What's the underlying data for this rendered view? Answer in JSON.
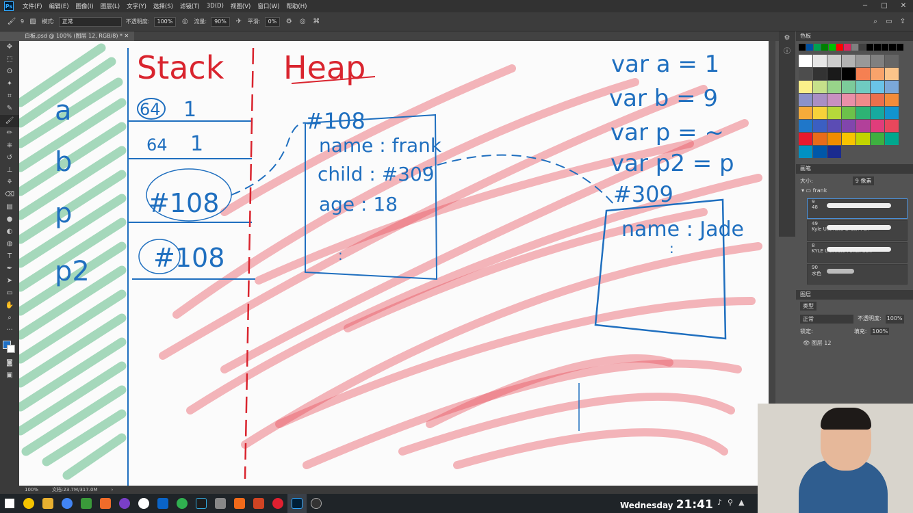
{
  "menubar": {
    "app_icon": "Ps",
    "items": [
      "文件(F)",
      "编辑(E)",
      "图像(I)",
      "图层(L)",
      "文字(Y)",
      "选择(S)",
      "滤镜(T)",
      "3D(D)",
      "视图(V)",
      "窗口(W)",
      "帮助(H)"
    ],
    "window_controls": [
      "─",
      "□",
      "✕"
    ]
  },
  "options": {
    "brush_size": "9",
    "mode_label": "模式:",
    "mode_value": "正常",
    "opacity_label": "不透明度:",
    "opacity_value": "100%",
    "flow_label": "流量:",
    "flow_value": "90%",
    "smooth_label": "平滑:",
    "smooth_value": "0%"
  },
  "document": {
    "tab_title": "白板.psd @ 100% (图层 12, RGB/8) *",
    "close": "✕"
  },
  "status": {
    "zoom": "100%",
    "doc_info": "文档:23.7M/317.0M"
  },
  "swatches_panel": {
    "title": "色板",
    "top_row": [
      "#000000",
      "#0050a0",
      "#00a050",
      "#008000",
      "#00c000",
      "#ff0000",
      "#e0245e",
      "#808080",
      "#404040",
      "#000000",
      "#000000",
      "#000000",
      "#000000",
      "#000000"
    ],
    "rows": [
      [
        "#ffffff",
        "#e6e6e6",
        "#cccccc",
        "#b3b3b3",
        "#999999",
        "#808080",
        "#666666"
      ],
      [
        "#4d4d4d",
        "#333333",
        "#1a1a1a",
        "#000000",
        "#f58052",
        "#f8a36b",
        "#fbc48a"
      ],
      [
        "#fbf08a",
        "#c6e08a",
        "#98d48a",
        "#7ccb9a",
        "#6fcbc1",
        "#6ac3e8",
        "#7ba8d9"
      ],
      [
        "#8b92c9",
        "#a98fc4",
        "#c890c1",
        "#ea8fa8",
        "#f08a8a",
        "#ec6f4c",
        "#f28c3a"
      ],
      [
        "#f5ab3a",
        "#f7d23a",
        "#b6d83a",
        "#6cc14a",
        "#2db374",
        "#17a99f",
        "#1294cf"
      ],
      [
        "#1f77c9",
        "#3b5fc2",
        "#5b4cb4",
        "#8146ad",
        "#b2409a",
        "#e03d7b",
        "#e8475c"
      ],
      [
        "#e8192c",
        "#e86b1a",
        "#f08c00",
        "#f8c400",
        "#c2d500",
        "#3eb040",
        "#00a78e"
      ],
      [
        "#0091c2",
        "#0057a8",
        "#1a2b8f"
      ]
    ]
  },
  "brushes_panel": {
    "title": "画笔",
    "size_label": "大小:",
    "size_value": "9 像素",
    "group": "frank",
    "items": [
      {
        "size": "9",
        "number": "48",
        "name": ""
      },
      {
        "size": "49",
        "number": "",
        "name": "Kyle Ultimate Brush Pen"
      },
      {
        "size": "8",
        "number": "",
        "name": "KYLE Ultimate Pencil Soft"
      },
      {
        "size": "90",
        "number": "",
        "name": "水色"
      }
    ]
  },
  "layers_panel": {
    "title": "图层",
    "filter": "类型",
    "blend": "正常",
    "opacity_label": "不透明度:",
    "opacity_value": "100%",
    "lock_label": "锁定:",
    "fill_label": "填充:",
    "fill_value": "100%",
    "layer_name": "图层 12"
  },
  "whiteboard": {
    "stack_title": "Stack",
    "heap_title": "Heap",
    "var_names": [
      "a",
      "b",
      "p",
      "p2"
    ],
    "stack_values": [
      "64",
      "1",
      "64",
      "1",
      "#108",
      "#108"
    ],
    "heap_address_1": "#108",
    "heap_obj1": [
      "name : frank",
      "child : #309",
      "age : 18",
      ":"
    ],
    "heap_address_2": "#309",
    "heap_obj2": [
      "name : Jade",
      ":"
    ],
    "code_lines": [
      "var a = 1",
      "var b = 9",
      "var p = ~",
      "var p2 = p"
    ]
  },
  "taskbar": {
    "day": "Wednesday",
    "time": "21:41"
  }
}
